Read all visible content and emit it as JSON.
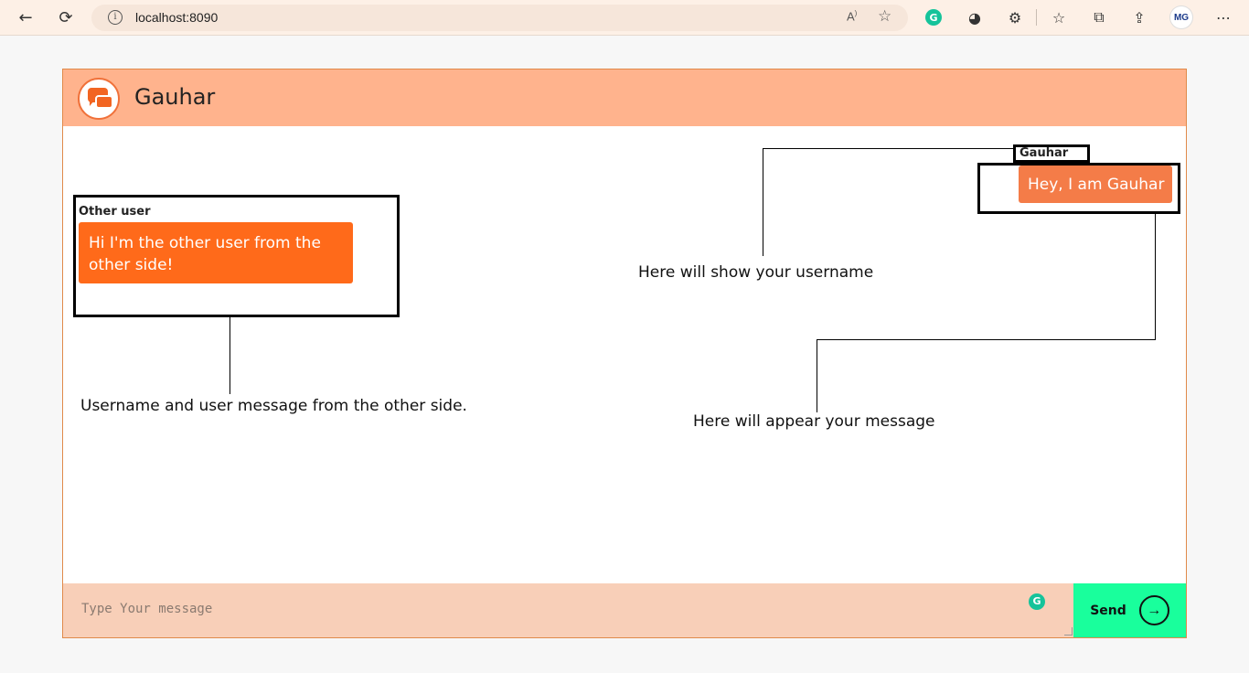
{
  "browser": {
    "url": "localhost:8090",
    "back_icon": "←",
    "reload_icon": "⟳",
    "readaloud_label": "A⁵",
    "profile_initials": "MG"
  },
  "header": {
    "title": "Gauhar"
  },
  "messages": {
    "other": {
      "username": "Other user",
      "text": "Hi I'm the other user from the other side!"
    },
    "mine": {
      "username": "Gauhar",
      "text": "Hey, I am Gauhar"
    }
  },
  "annotations": {
    "other_side": "Username and user message from the other side.",
    "your_username": "Here will show your username",
    "your_message": "Here will appear your message"
  },
  "footer": {
    "input_placeholder": "Type Your message",
    "send_label": "Send",
    "send_icon": "→"
  },
  "colors": {
    "header_bg": "#ffb38d",
    "footer_bg": "#f8cfb8",
    "send_bg": "#19ff9c",
    "bubble_other": "#ff6a1a",
    "bubble_mine": "#f47c48"
  }
}
